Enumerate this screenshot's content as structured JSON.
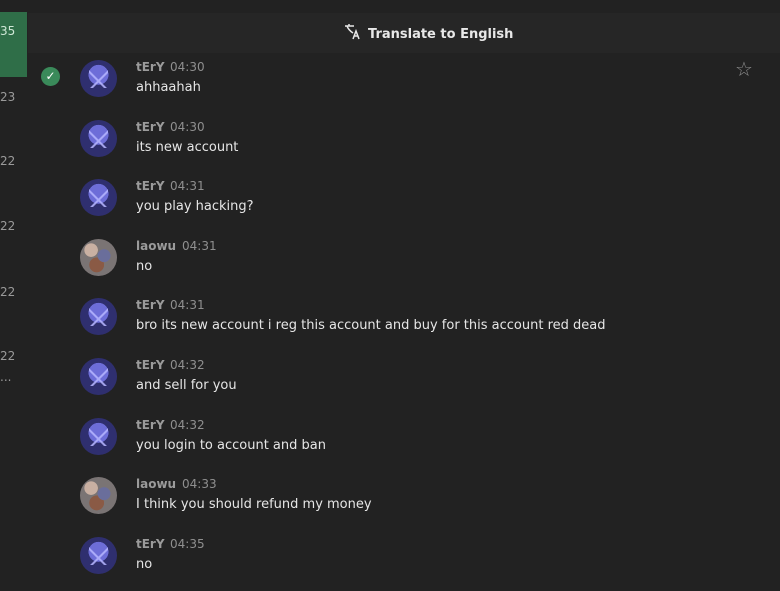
{
  "left_panel": {
    "numbers": [
      "35",
      "23",
      "22",
      "22",
      "22",
      "22",
      "..."
    ]
  },
  "topbar": {
    "translate_label": "Translate to English",
    "translate_icon": "translate-icon"
  },
  "icons": {
    "check": "check-circle-icon",
    "star": "star-outline-icon"
  },
  "messages": [
    {
      "author": "tErY",
      "time": "04:30",
      "text": "ahhaahah",
      "avatar": "tery"
    },
    {
      "author": "tErY",
      "time": "04:30",
      "text": "its new account",
      "avatar": "tery"
    },
    {
      "author": "tErY",
      "time": "04:31",
      "text": "you play hacking?",
      "avatar": "tery"
    },
    {
      "author": "laowu",
      "time": "04:31",
      "text": "no",
      "avatar": "laowu"
    },
    {
      "author": "tErY",
      "time": "04:31",
      "text": "bro its new account i reg this account and buy for this account red dead",
      "avatar": "tery"
    },
    {
      "author": "tErY",
      "time": "04:32",
      "text": "and sell for you",
      "avatar": "tery"
    },
    {
      "author": "tErY",
      "time": "04:32",
      "text": "you login to account and ban",
      "avatar": "tery"
    },
    {
      "author": "laowu",
      "time": "04:33",
      "text": "I think you should refund my money",
      "avatar": "laowu"
    },
    {
      "author": "tErY",
      "time": "04:35",
      "text": "no",
      "avatar": "tery"
    }
  ]
}
